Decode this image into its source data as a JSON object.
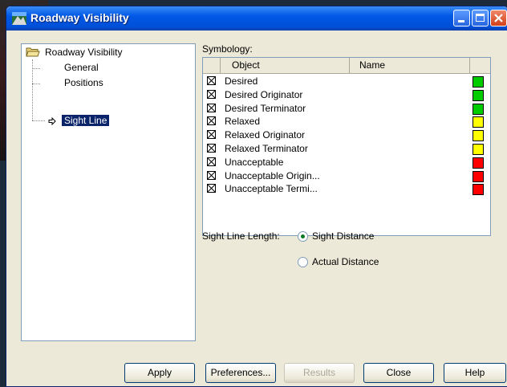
{
  "window": {
    "title": "Roadway Visibility"
  },
  "tree": {
    "root": "Roadway Visibility",
    "items": [
      "General",
      "Positions",
      "Sight Line"
    ],
    "selected": "Sight Line"
  },
  "symbology": {
    "label": "Symbology:",
    "columns": [
      "Object",
      "Name"
    ],
    "rows": [
      {
        "label": "Desired",
        "checked": true,
        "color": "#00cc00"
      },
      {
        "label": "Desired Originator",
        "checked": true,
        "color": "#00cc00"
      },
      {
        "label": "Desired Terminator",
        "checked": true,
        "color": "#00cc00"
      },
      {
        "label": "Relaxed",
        "checked": true,
        "color": "#ffff00"
      },
      {
        "label": "Relaxed Originator",
        "checked": true,
        "color": "#ffff00"
      },
      {
        "label": "Relaxed Terminator",
        "checked": true,
        "color": "#ffff00"
      },
      {
        "label": "Unacceptable",
        "checked": true,
        "color": "#ff0000"
      },
      {
        "label": "Unacceptable Origin...",
        "checked": true,
        "color": "#ff0000"
      },
      {
        "label": "Unacceptable Termi...",
        "checked": true,
        "color": "#ff0000"
      }
    ]
  },
  "sight_line": {
    "label": "Sight Line Length:",
    "options": [
      {
        "label": "Sight Distance",
        "selected": true
      },
      {
        "label": "Actual Distance",
        "selected": false
      }
    ]
  },
  "buttons": {
    "apply": "Apply",
    "preferences": "Preferences...",
    "results": "Results",
    "close": "Close",
    "help": "Help"
  }
}
